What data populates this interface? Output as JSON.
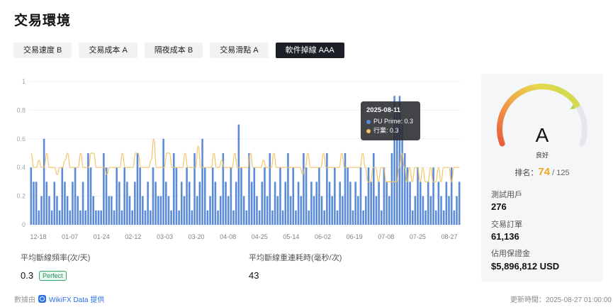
{
  "page": {
    "title": "交易環境"
  },
  "tabs": [
    {
      "label": "交易速度 B",
      "active": false
    },
    {
      "label": "交易成本 A",
      "active": false
    },
    {
      "label": "隔夜成本 B",
      "active": false
    },
    {
      "label": "交易滑點 A",
      "active": false
    },
    {
      "label": "軟件掉線 AAA",
      "active": true
    }
  ],
  "chart_data": {
    "type": "bar",
    "ylim": [
      0,
      1
    ],
    "y_ticks": [
      "0",
      "0.2",
      "0.4",
      "0.6",
      "0.8",
      "1"
    ],
    "x_ticks": [
      "12-18",
      "01-07",
      "01-24",
      "02-12",
      "03-03",
      "03-20",
      "04-08",
      "04-25",
      "05-14",
      "06-02",
      "06-19",
      "07-08",
      "07-25",
      "08-27"
    ],
    "grid": true,
    "series": [
      {
        "name": "PU Prime",
        "type": "bar",
        "color": "#5b8bd8",
        "values": [
          0.4,
          0.3,
          0.3,
          0.1,
          0.2,
          0.6,
          0.3,
          0.2,
          0.1,
          0.3,
          0.2,
          0.1,
          0.4,
          0.3,
          0.2,
          0.1,
          0.3,
          0.4,
          0.2,
          0.1,
          0.3,
          0.1,
          0.5,
          0.4,
          0.2,
          0.1,
          0.1,
          0.1,
          0.5,
          0.4,
          0.2,
          0.2,
          0.1,
          0.4,
          0.3,
          0.1,
          0.4,
          0.3,
          0.2,
          0.1,
          0.3,
          0.5,
          0.4,
          0.2,
          0.1,
          0.3,
          0.1,
          0.4,
          0.3,
          0.2,
          0.2,
          0.6,
          0.3,
          0.2,
          0.1,
          0.5,
          0.4,
          0.1,
          0.3,
          0.2,
          0.4,
          0.3,
          0.1,
          0.5,
          0.2,
          0.3,
          0.6,
          0.4,
          0.1,
          0.2,
          0.4,
          0.3,
          0.1,
          0.2,
          0.5,
          0.3,
          0.2,
          0.4,
          0.1,
          0.3,
          0.7,
          0.4,
          0.2,
          0.1,
          0.5,
          0.3,
          0.4,
          0.2,
          0.1,
          0.3,
          0.4,
          0.2,
          0.5,
          0.1,
          0.3,
          0.2,
          0.4,
          0.1,
          0.3,
          0.5,
          0.2,
          0.4,
          0.1,
          0.3,
          0.2,
          0.5,
          0.4,
          0.1,
          0.3,
          0.2,
          0.3,
          0.4,
          0.2,
          0.1,
          0.5,
          0.3,
          0.2,
          0.4,
          0.1,
          0.3,
          0.2,
          0.5,
          0.4,
          0.3,
          0.1,
          0.3,
          0.2,
          0.4,
          0.1,
          0.2,
          0.4,
          0.3,
          0.5,
          0.2,
          0.3,
          0.1,
          0.4,
          0.3,
          0.2,
          0.5,
          0.9,
          0.8,
          0.9,
          0.7,
          0.5,
          0.4,
          0.3,
          0.1,
          0.2,
          0.4,
          0.3,
          0.2,
          0.1,
          0.3,
          0.2,
          0.4,
          0.1,
          0.3,
          0.2,
          0.1,
          0.3,
          0.2,
          0.4,
          0.1,
          0.2,
          0.3
        ]
      },
      {
        "name": "行業",
        "type": "line",
        "color": "#f2c46a",
        "values": [
          0.5,
          0.4,
          0.4,
          0.45,
          0.4,
          0.4,
          0.5,
          0.4,
          0.4,
          0.4,
          0.35,
          0.4,
          0.4,
          0.45,
          0.5,
          0.4,
          0.4,
          0.4,
          0.4,
          0.5,
          0.4,
          0.4,
          0.4,
          0.5,
          0.5,
          0.4,
          0.4,
          0.4,
          0.4,
          0.35,
          0.4,
          0.4,
          0.4,
          0.4,
          0.4,
          0.5,
          0.4,
          0.4,
          0.4,
          0.4,
          0.5,
          0.5,
          0.4,
          0.4,
          0.4,
          0.4,
          0.45,
          0.6,
          0.4,
          0.4,
          0.4,
          0.4,
          0.5,
          0.5,
          0.4,
          0.4,
          0.4,
          0.4,
          0.4,
          0.5,
          0.4,
          0.4,
          0.4,
          0.4,
          0.55,
          0.4,
          0.4,
          0.4,
          0.4,
          0.4,
          0.5,
          0.4,
          0.4,
          0.45,
          0.4,
          0.4,
          0.4,
          0.4,
          0.5,
          0.4,
          0.4,
          0.4,
          0.4,
          0.4,
          0.5,
          0.4,
          0.4,
          0.4,
          0.4,
          0.45,
          0.4,
          0.4,
          0.4,
          0.5,
          0.4,
          0.4,
          0.4,
          0.4,
          0.4,
          0.4,
          0.4,
          0.4,
          0.4,
          0.4,
          0.35,
          0.4,
          0.5,
          0.4,
          0.4,
          0.4,
          0.4,
          0.4,
          0.5,
          0.4,
          0.4,
          0.4,
          0.4,
          0.4,
          0.4,
          0.5,
          0.4,
          0.4,
          0.4,
          0.4,
          0.4,
          0.4,
          0.4,
          0.5,
          0.4,
          0.3,
          0.3,
          0.4,
          0.4,
          0.3,
          0.4,
          0.4,
          0.3,
          0.3,
          0.3,
          0.3,
          0.3,
          0.4,
          0.5,
          0.4,
          0.3,
          0.4,
          0.3,
          0.4,
          0.4,
          0.3,
          0.4,
          0.3,
          0.3,
          0.4,
          0.3,
          0.3,
          0.4,
          0.3,
          0.4,
          0.4,
          0.4,
          0.3,
          0.4,
          0.4,
          0.4
        ]
      }
    ],
    "tooltip": {
      "date": "2025-08-11",
      "rows": [
        {
          "label": "PU Prime: 0.3",
          "color": "#5b8bd8"
        },
        {
          "label": "行業: 0.3",
          "color": "#f2c46a"
        }
      ]
    }
  },
  "stats": {
    "disconnect_freq_label": "平均斷線頻率(次/天)",
    "disconnect_freq_value": "0.3",
    "disconnect_badge": "Perfect",
    "reconnect_label": "平均斷線重連耗時(毫秒/次)",
    "reconnect_value": "43"
  },
  "footer": {
    "source_prefix": "數據由",
    "provider": "WikiFX Data 提供",
    "updated": "更新時間：2025-08-27 01:00:00"
  },
  "rating_panel": {
    "grade": "A",
    "grade_label": "良好",
    "rank_prefix": "排名：",
    "rank_value": "74",
    "rank_total": "/ 125",
    "gauge_level": 0.75,
    "metrics": [
      {
        "label": "測試用戶",
        "value": "276"
      },
      {
        "label": "交易訂單",
        "value": "61,136"
      },
      {
        "label": "佔用保證金",
        "value": "$5,896,812 USD"
      }
    ]
  }
}
